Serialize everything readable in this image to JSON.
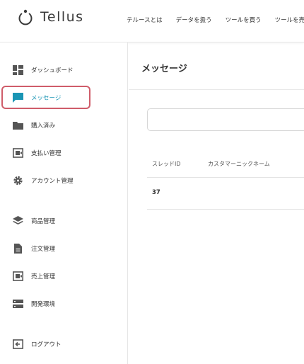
{
  "header": {
    "logo_text": "Tellus",
    "nav": [
      "テルースとは",
      "データを扱う",
      "ツールを買う",
      "ツールを売"
    ]
  },
  "sidebar": {
    "items": [
      {
        "label": "ダッシュボード",
        "icon": "dashboard-icon"
      },
      {
        "label": "メッセージ",
        "icon": "message-icon",
        "active": true
      },
      {
        "label": "購入済み",
        "icon": "folder-icon"
      },
      {
        "label": "支払い管理",
        "icon": "payment-icon"
      },
      {
        "label": "アカウント管理",
        "icon": "gear-icon"
      },
      {
        "label": "商品管理",
        "icon": "layers-icon"
      },
      {
        "label": "注文管理",
        "icon": "document-icon"
      },
      {
        "label": "売上管理",
        "icon": "sales-icon"
      },
      {
        "label": "開発環境",
        "icon": "server-icon"
      },
      {
        "label": "ログアウト",
        "icon": "logout-icon"
      }
    ]
  },
  "main": {
    "title": "メッセージ",
    "search": {
      "value": "",
      "placeholder": ""
    },
    "table": {
      "columns": [
        "スレッドID",
        "カスタマーニックネーム"
      ],
      "rows": [
        [
          "37",
          ""
        ]
      ]
    }
  },
  "colors": {
    "accent": "#1a95b4",
    "icon_gray": "#555555",
    "highlight": "#cf5d6a",
    "border": "#e6e6e6"
  }
}
